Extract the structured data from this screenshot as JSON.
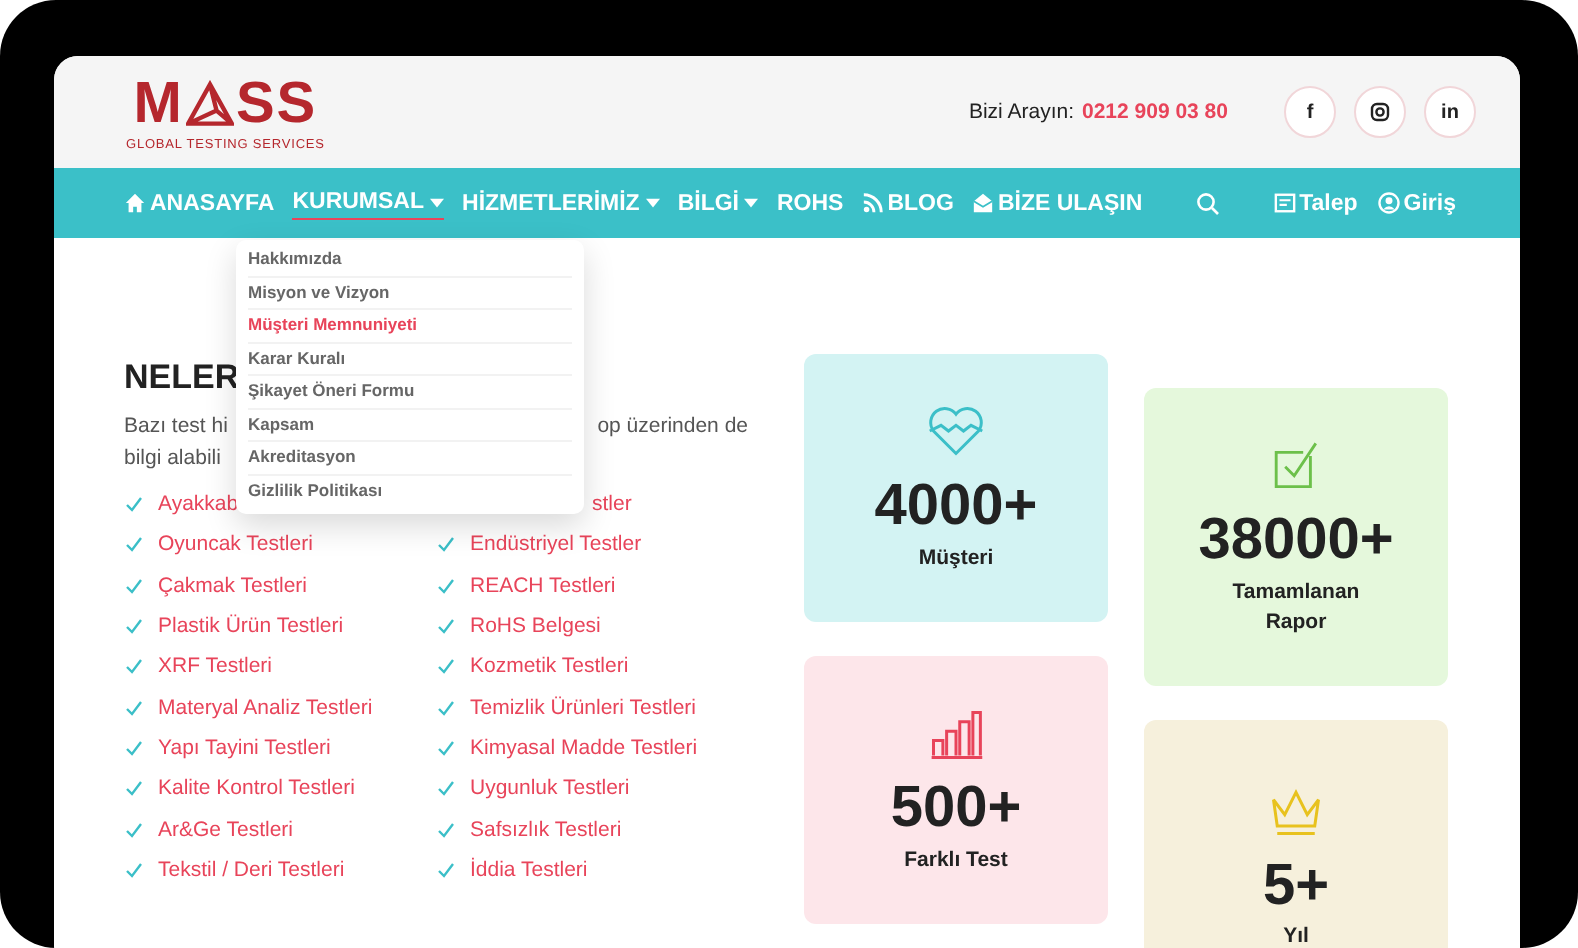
{
  "header": {
    "logo": {
      "start": "M",
      "end": "SS",
      "tagline": "GLOBAL TESTING SERVICES"
    },
    "phone_label": "Bizi Arayın:",
    "phone": "0212 909 03 80",
    "social": [
      {
        "kind": "facebook",
        "label": "f"
      },
      {
        "kind": "instagram"
      },
      {
        "kind": "linkedin",
        "label": "in"
      }
    ]
  },
  "nav": {
    "items": [
      {
        "label": "ANASAYFA",
        "kind": "home",
        "dropdown": false,
        "selected": false
      },
      {
        "label": "KURUMSAL",
        "dropdown": true,
        "selected": true
      },
      {
        "label": "HİZMETLERİMİZ",
        "dropdown": true,
        "selected": false
      },
      {
        "label": "BİLGİ",
        "dropdown": true,
        "selected": false
      },
      {
        "label": "ROHS",
        "dropdown": false,
        "selected": false
      },
      {
        "label": "BLOG",
        "kind": "rss",
        "dropdown": false,
        "selected": false
      },
      {
        "label": "BİZE ULAŞIN",
        "kind": "mail",
        "dropdown": false,
        "selected": false
      }
    ],
    "right": [
      {
        "label": "Talep",
        "kind": "form"
      },
      {
        "label": "Giriş",
        "kind": "user"
      }
    ]
  },
  "dropdown": [
    {
      "label": "Hakkımızda",
      "selected": false
    },
    {
      "label": "Misyon ve Vizyon",
      "selected": false
    },
    {
      "label": "Müşteri Memnuniyeti",
      "selected": true
    },
    {
      "label": "Karar Kuralı",
      "selected": false
    },
    {
      "label": "Şikayet Öneri Formu",
      "selected": false
    },
    {
      "label": "Kapsam",
      "selected": false
    },
    {
      "label": "Akreditasyon",
      "selected": false
    },
    {
      "label": "Gizlilik Politikası",
      "selected": false
    }
  ],
  "intro": {
    "heading": "NELER",
    "line_1_start": "Bazı test hi",
    "line_1_end": "op üzerinden de",
    "line_2": "bilgi alabili"
  },
  "tests": [
    [
      {
        "text": "Ayakkab",
        "kind": "plain"
      },
      {
        "text": "Oyuncak Testleri",
        "kind": "plain"
      },
      {
        "text": "Çakmak Testleri",
        "kind": "plain"
      },
      {
        "text": "Plastik Ürün Testleri",
        "kind": "plain"
      },
      {
        "text": "XRF Testleri",
        "kind": "plain"
      },
      {
        "text": "Materyal Analiz Testleri",
        "kind": "plain"
      },
      {
        "text": "Yapı Tayini Testleri",
        "kind": "plain"
      },
      {
        "text": "Kalite Kontrol Testleri",
        "kind": "plain"
      },
      {
        "text": "Ar&Ge Testleri",
        "kind": "plain"
      },
      {
        "text": "Tekstil / Deri Testleri",
        "kind": "plain"
      }
    ],
    [
      {
        "text": "stler",
        "kind": "covered"
      },
      {
        "text": "Endüstriyel Testler",
        "kind": "plain"
      },
      {
        "text": "REACH Testleri",
        "kind": "plain"
      },
      {
        "text": "RoHS Belgesi",
        "kind": "plain"
      },
      {
        "text": "Kozmetik Testleri",
        "kind": "plain"
      },
      {
        "text": "Temizlik Ürünleri Testleri",
        "kind": "plain"
      },
      {
        "text": "Kimyasal Madde Testleri",
        "kind": "plain"
      },
      {
        "text": "Uygunluk Testleri",
        "kind": "plain"
      },
      {
        "text": "Safsızlık Testleri",
        "kind": "plain"
      },
      {
        "text": "İddia Testleri",
        "kind": "plain"
      }
    ]
  ],
  "stats": [
    [
      {
        "kind": "heart",
        "color": "#3bbfc8",
        "value": "4000+",
        "label": "Müşteri"
      },
      {
        "kind": "chart",
        "color": "#e8445a",
        "value": "500+",
        "label": "Farklı Test"
      }
    ],
    [
      {
        "kind": "check",
        "color": "#6cc04a",
        "value": "38000+",
        "label": "Tamamlanan Rapor"
      },
      {
        "kind": "crown",
        "color": "#e8c21e",
        "value": "5+",
        "label": "Yıl"
      }
    ]
  ]
}
